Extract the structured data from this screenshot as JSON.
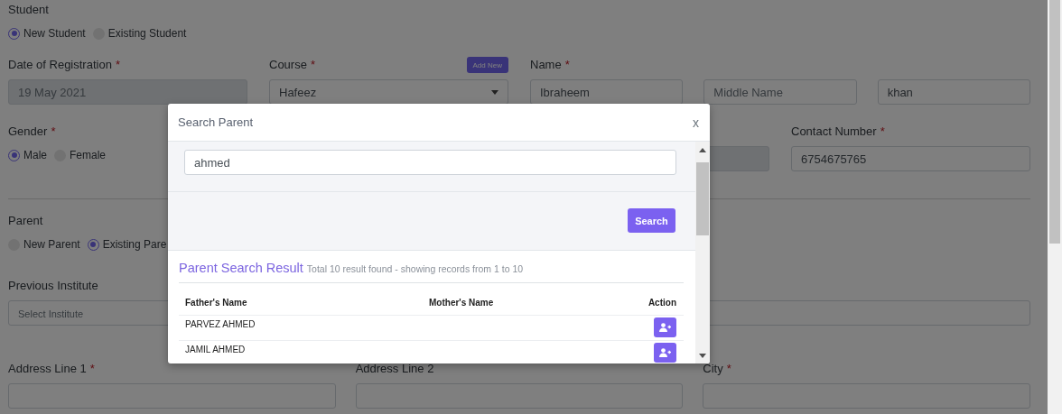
{
  "student": {
    "label": "Student",
    "options": [
      {
        "label": "New Student",
        "selected": true
      },
      {
        "label": "Existing Student",
        "selected": false
      }
    ]
  },
  "registration_date": {
    "label": "Date of Registration",
    "required_mark": "*",
    "value": "19 May 2021",
    "disabled": true
  },
  "course": {
    "label": "Course",
    "required_mark": "*",
    "value": "Hafeez",
    "kind": "select",
    "add_button": "Add New"
  },
  "name": {
    "label": "Name",
    "required_mark": "*",
    "parts": [
      {
        "value": "Ibraheem"
      },
      {
        "placeholder": "Middle Name"
      },
      {
        "value": "khan"
      }
    ]
  },
  "gender": {
    "label": "Gender",
    "required_mark": "*",
    "options": [
      {
        "label": "Male",
        "selected": true
      },
      {
        "label": "Female",
        "selected": false
      }
    ]
  },
  "field_3": {
    "disabled": true
  },
  "contact_number": {
    "label": "Contact Number",
    "required_mark": "*",
    "value": "6754675765"
  },
  "parent": {
    "label": "Parent",
    "options": [
      {
        "label": "New Parent",
        "selected": false
      },
      {
        "label": "Existing Pare",
        "selected": true
      }
    ]
  },
  "previous_institute": {
    "label": "Previous Institute",
    "placeholder": "Select Institute"
  },
  "field_6": {
    "disabled": false
  },
  "address": [
    {
      "label": "Address Line 1",
      "required_mark": "*"
    },
    {
      "label": "Address Line 2"
    },
    {
      "label": "City",
      "required_mark": "*"
    }
  ],
  "modal": {
    "title": "Search Parent",
    "close": "x",
    "search_value": "ahmed",
    "search_button": "Search",
    "result_title": "Parent Search Result",
    "result_summary": "Total 10 result found - showing records from 1 to 10",
    "columns": [
      "Father's Name",
      "Mother's Name",
      "Action"
    ],
    "rows": [
      {
        "father": "PARVEZ AHMED"
      },
      {
        "father": "JAMIL AHMED"
      }
    ]
  }
}
